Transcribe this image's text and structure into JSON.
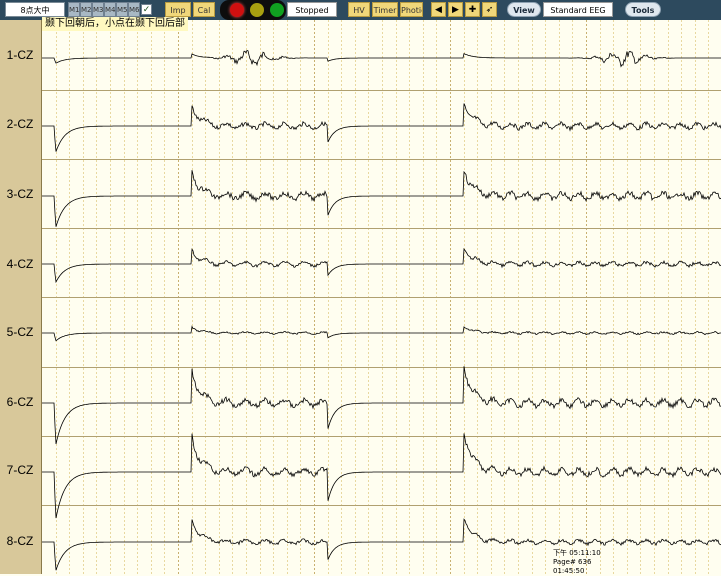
{
  "toolbar": {
    "montage_value": "8点大中",
    "montage_buttons": [
      "M1",
      "M2",
      "M3",
      "M4",
      "M5",
      "M6"
    ],
    "imp_label": "Imp",
    "cal_label": "Cal",
    "status_text": "Stopped",
    "hv_label": "HV",
    "timer_label": "Timer",
    "photic_label": "Photic",
    "view_label": "View",
    "view_select_value": "Standard EEG View",
    "tools_label": "Tools",
    "lights": {
      "red": "#d01010",
      "yellow": "#a8a010",
      "green": "#10a020"
    }
  },
  "annotation_note": "颞下回朝后，小点在颞下回后部",
  "channels": [
    "1-CZ",
    "2-CZ",
    "3-CZ",
    "4-CZ",
    "5-CZ",
    "6-CZ",
    "7-CZ",
    "8-CZ"
  ],
  "status": {
    "time": "下午 05:11:10",
    "page": "Page# 636",
    "elapsed": "01:45:50"
  },
  "colors": {
    "toolbar_bg": "#2d4a5e",
    "label_bg": "#d8c89a",
    "trace_bg": "#fffef0",
    "grid": "#e8d8a0",
    "trace": "#000000"
  }
}
